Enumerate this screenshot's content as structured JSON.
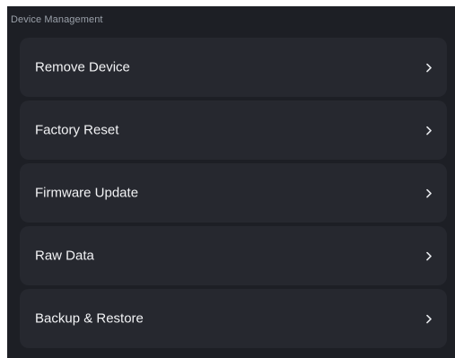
{
  "section": {
    "title": "Device Management"
  },
  "items": [
    {
      "label": "Remove Device",
      "icon": "chevron-right-icon"
    },
    {
      "label": "Factory Reset",
      "icon": "chevron-right-icon"
    },
    {
      "label": "Firmware Update",
      "icon": "chevron-right-icon"
    },
    {
      "label": "Raw Data",
      "icon": "chevron-right-icon"
    },
    {
      "label": "Backup & Restore",
      "icon": "chevron-right-icon"
    }
  ],
  "colors": {
    "panel_background": "#1d1f25",
    "item_background": "#26282f",
    "text": "#f2f3f5",
    "muted_text": "#9aa0a9"
  }
}
